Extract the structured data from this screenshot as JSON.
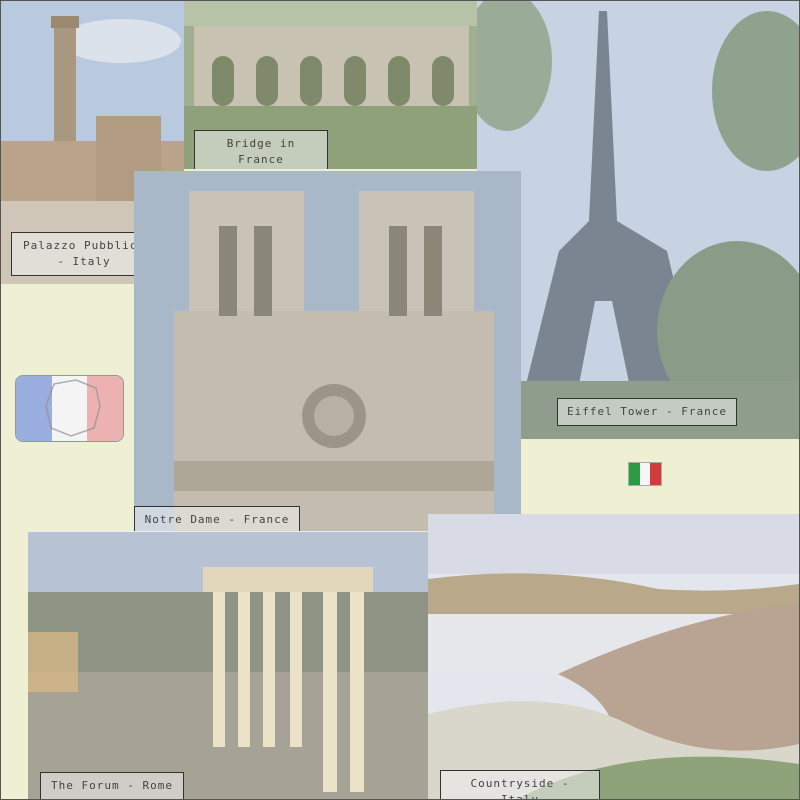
{
  "gallery": {
    "photos": [
      {
        "id": "palazzo",
        "caption": "Palazzo Pubblico\n- Italy"
      },
      {
        "id": "bridge",
        "caption": "Bridge in France"
      },
      {
        "id": "eiffel",
        "caption": "Eiffel Tower - France"
      },
      {
        "id": "notredame",
        "caption": "Notre Dame - France"
      },
      {
        "id": "forum",
        "caption": "The Forum - Rome"
      },
      {
        "id": "countryside",
        "caption": "Countryside - Italy"
      }
    ],
    "flags": [
      {
        "id": "france",
        "icon": "france-map-flag-icon",
        "colors": [
          "#2d4aa8",
          "#ffffff",
          "#d8343a"
        ]
      },
      {
        "id": "italy",
        "icon": "italy-flag-icon",
        "colors": [
          "#1f8f3a",
          "#ffffff",
          "#cc2b2b"
        ]
      }
    ],
    "background_color": "#efefd4"
  }
}
